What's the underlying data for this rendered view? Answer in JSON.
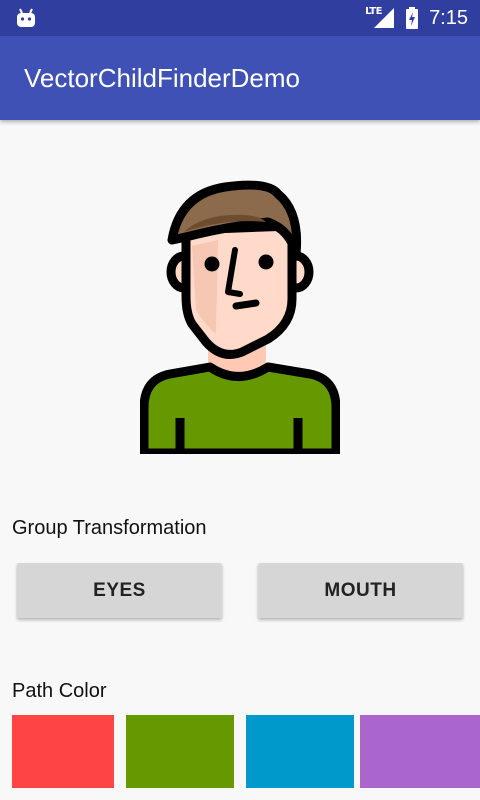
{
  "status_bar": {
    "network": "LTE",
    "time": "7:15",
    "icons": [
      "android-debug-icon",
      "signal-icon",
      "battery-charging-icon"
    ]
  },
  "app_bar": {
    "title": "VectorChildFinderDemo"
  },
  "main": {
    "group_label": "Group Transformation",
    "buttons": [
      {
        "label": "EYES"
      },
      {
        "label": "MOUTH"
      }
    ],
    "path_label": "Path Color",
    "swatches": [
      {
        "color": "#ff4444"
      },
      {
        "color": "#669900"
      },
      {
        "color": "#0099cc"
      },
      {
        "color": "#aa66cc"
      }
    ]
  },
  "colors": {
    "status_bar": "#303f9f",
    "app_bar": "#3f51b5",
    "background": "#f8f8f8",
    "button": "#d6d6d6",
    "shirt": "#669900",
    "hair": "#8c6a4c",
    "skin": "#ffd9c9"
  }
}
